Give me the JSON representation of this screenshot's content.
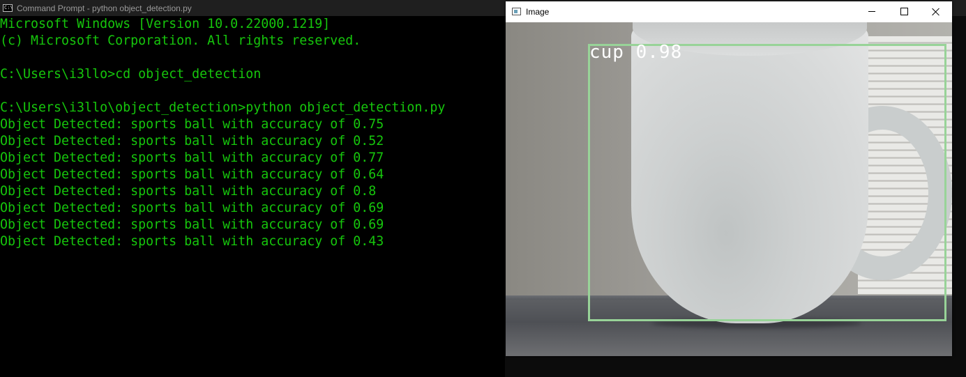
{
  "cmd_window": {
    "title": "Command Prompt - python  object_detection.py",
    "lines": [
      "Microsoft Windows [Version 10.0.22000.1219]",
      "(c) Microsoft Corporation. All rights reserved.",
      "",
      "C:\\Users\\i3llo>cd object_detection",
      "",
      "C:\\Users\\i3llo\\object_detection>python object_detection.py",
      "Object Detected: sports ball with accuracy of 0.75",
      "Object Detected: sports ball with accuracy of 0.52",
      "Object Detected: sports ball with accuracy of 0.77",
      "Object Detected: sports ball with accuracy of 0.64",
      "Object Detected: sports ball with accuracy of 0.8",
      "Object Detected: sports ball with accuracy of 0.69",
      "Object Detected: sports ball with accuracy of 0.69",
      "Object Detected: sports ball with accuracy of 0.43"
    ],
    "text_color": "#16c60c",
    "background": "#000000",
    "icon": "cmd-icon"
  },
  "image_window": {
    "title": "Image",
    "icon": "image-window-icon",
    "controls": {
      "minimize": "minimize-icon",
      "maximize": "maximize-icon",
      "close": "close-icon"
    },
    "detection": {
      "label": "cup 0.98",
      "box_color": "#98d398"
    }
  }
}
